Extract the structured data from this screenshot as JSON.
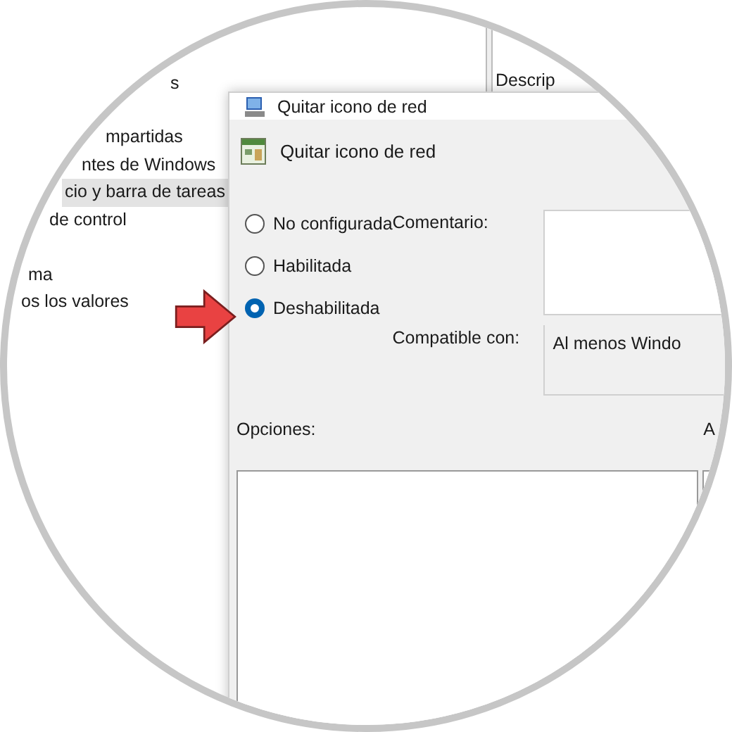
{
  "tree": {
    "items": [
      {
        "label": "s",
        "selected": false
      },
      {
        "label": "mpartidas",
        "selected": false
      },
      {
        "label": "ntes de Windows",
        "selected": false
      },
      {
        "label": "cio y barra de tareas",
        "selected": true
      },
      {
        "label": "de control",
        "selected": false
      },
      {
        "label": "ma",
        "selected": false
      },
      {
        "label": "os los valores",
        "selected": false
      }
    ]
  },
  "description_panel": {
    "heading": "Descrip"
  },
  "dialog": {
    "title": "Quitar icono de red",
    "header": "Quitar icono de red",
    "states": [
      {
        "label": "No configurada",
        "selected": false
      },
      {
        "label": "Habilitada",
        "selected": false
      },
      {
        "label": "Deshabilitada",
        "selected": true
      }
    ],
    "comment": {
      "label": "Comentario:"
    },
    "compatible": {
      "label": "Compatible con:",
      "value": "Al menos Windo"
    },
    "options_label": "Opciones:",
    "help_label": "A"
  }
}
